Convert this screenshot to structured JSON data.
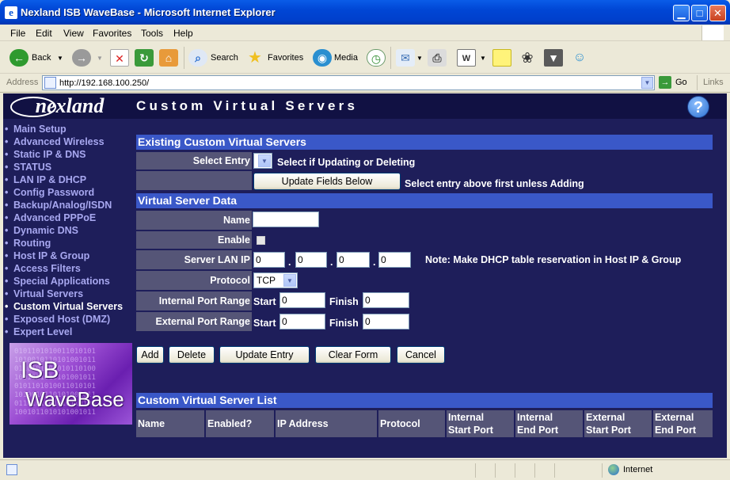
{
  "window": {
    "title": "Nexland ISB WaveBase - Microsoft Internet Explorer",
    "app_icon": "e"
  },
  "menu": [
    "File",
    "Edit",
    "View",
    "Favorites",
    "Tools",
    "Help"
  ],
  "toolbar": {
    "back": "Back",
    "search": "Search",
    "favorites": "Favorites",
    "media": "Media"
  },
  "address": {
    "label": "Address",
    "url": "http://192.168.100.250/",
    "go": "Go",
    "links": "Links"
  },
  "header": {
    "logo": "nexland",
    "title": "Custom Virtual Servers",
    "help": "?"
  },
  "nav": [
    "Main Setup",
    "Advanced Wireless",
    "Static IP & DNS",
    "STATUS",
    "LAN IP & DHCP",
    "Config Password",
    "Backup/Analog/ISDN",
    "Advanced PPPoE",
    "Dynamic DNS",
    "Routing",
    "Host IP & Group",
    "Access Filters",
    "Special Applications",
    "Virtual Servers",
    "Custom Virtual Servers",
    "Exposed Host (DMZ)",
    "Expert Level"
  ],
  "nav_active": 14,
  "nav_bullet": "•",
  "promo": {
    "line1": "ISB",
    "line2": "WaveBase"
  },
  "existing": {
    "header": "Existing Custom Virtual Servers",
    "select_label": "Select Entry",
    "select_hint": "Select if Updating or Deleting",
    "update_button": "Update Fields Below",
    "update_hint": "Select entry above first unless Adding"
  },
  "vsdata": {
    "header": "Virtual Server Data",
    "name_label": "Name",
    "name_value": "",
    "enable_label": "Enable",
    "enabled": false,
    "server_ip_label": "Server LAN IP",
    "ip": [
      "0",
      "0",
      "0",
      "0"
    ],
    "ip_dot": ".",
    "ip_note": "Note: Make DHCP table reservation in Host IP & Group",
    "protocol_label": "Protocol",
    "protocol_value": "TCP",
    "internal_label": "Internal Port Range",
    "external_label": "External Port Range",
    "start_label": "Start",
    "finish_label": "Finish",
    "internal_start": "0",
    "internal_finish": "0",
    "external_start": "0",
    "external_finish": "0"
  },
  "actions": {
    "add": "Add",
    "delete": "Delete",
    "update": "Update Entry",
    "clear": "Clear Form",
    "cancel": "Cancel"
  },
  "list": {
    "header": "Custom Virtual Server List",
    "columns": [
      "Name",
      "Enabled?",
      "IP Address",
      "Protocol",
      "Internal Start Port",
      "Internal End Port",
      "External Start Port",
      "External End Port"
    ],
    "columns_two_line": [
      [
        "Internal",
        "Start Port"
      ],
      [
        "Internal",
        "End Port"
      ],
      [
        "External",
        "Start Port"
      ],
      [
        "External",
        "End Port"
      ]
    ]
  },
  "status": {
    "zone": "Internet"
  }
}
